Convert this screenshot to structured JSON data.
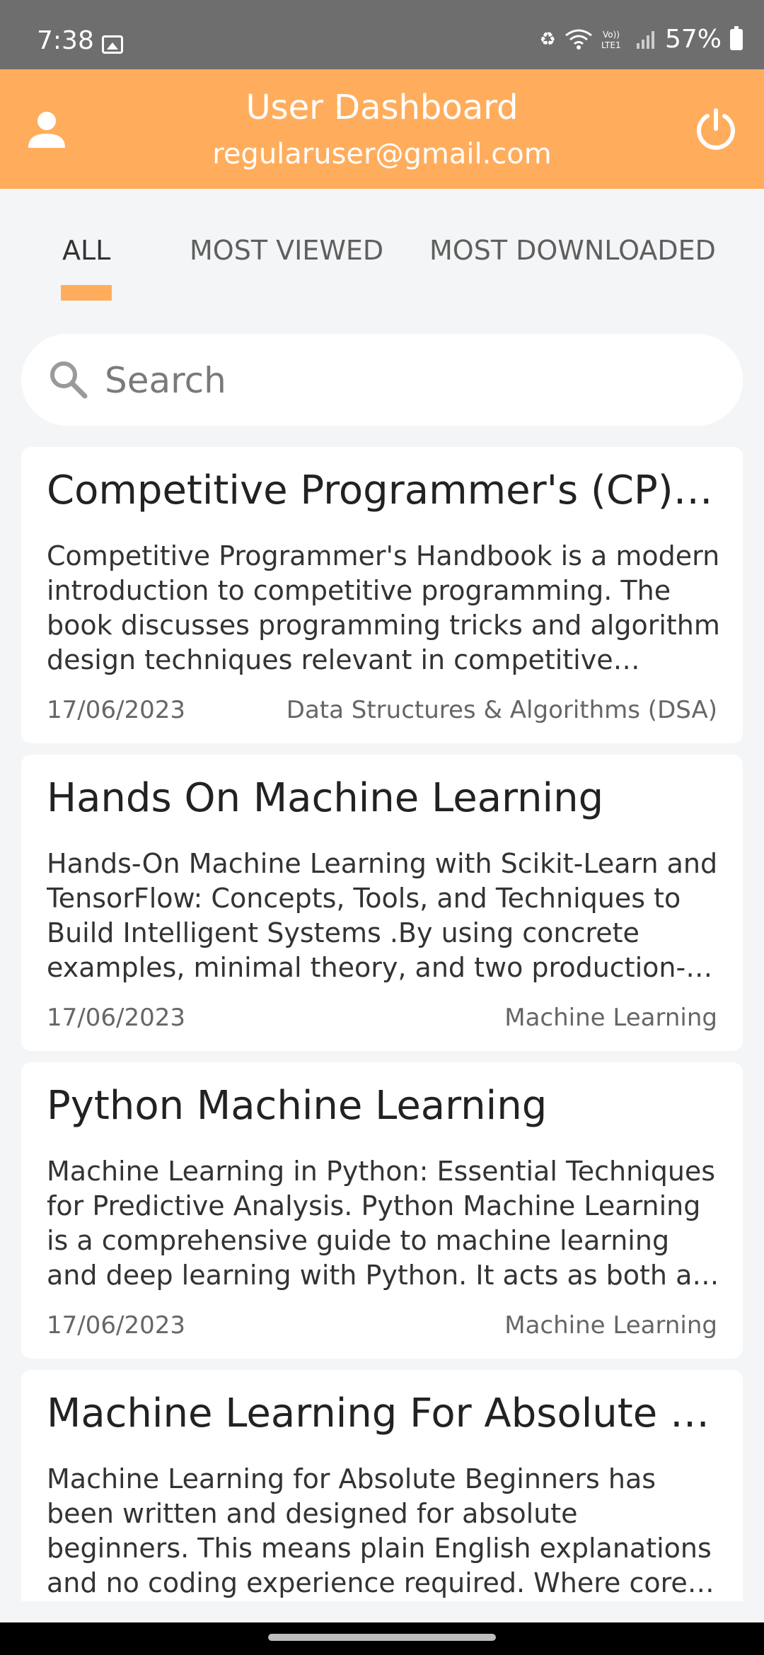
{
  "status_bar": {
    "time": "7:38",
    "battery": "57%",
    "icons": [
      "gallery-icon",
      "recycle-icon",
      "wifi-icon",
      "volte-icon",
      "signal-icon",
      "battery-icon"
    ]
  },
  "header": {
    "title": "User Dashboard",
    "email": "regularuser@gmail.com",
    "accent_color": "#ffad5c"
  },
  "tabs": [
    {
      "label": "ALL",
      "active": true
    },
    {
      "label": "MOST VIEWED",
      "active": false
    },
    {
      "label": "MOST DOWNLOADED",
      "active": false
    }
  ],
  "search": {
    "placeholder": "Search",
    "value": ""
  },
  "cards": [
    {
      "title": "Competitive Programmer's (CP) Handbook",
      "description": "Competitive Programmer's Handbook is a modern introduction to competitive programming. The book discusses programming tricks and algorithm design techniques relevant in competitive programming.",
      "date": "17/06/2023",
      "category": "Data Structures & Algorithms (DSA)"
    },
    {
      "title": "Hands On Machine Learning",
      "description": "Hands-On Machine Learning with Scikit-Learn and TensorFlow: Concepts, Tools, and Techniques to Build Intelligent Systems .By using concrete examples, minimal theory, and two production-ready Python frameworks",
      "date": "17/06/2023",
      "category": "Machine Learning"
    },
    {
      "title": "Python Machine Learning",
      "description": "Machine Learning in Python: Essential Techniques for Predictive Analysis. Python Machine Learning is a comprehensive guide to machine learning and deep learning with Python. It acts as both a step-by-step tutorial",
      "date": "17/06/2023",
      "category": "Machine Learning"
    },
    {
      "title": "Machine Learning For Absolute Beginners",
      "description": "Machine Learning for Absolute Beginners has been written and designed for absolute beginners. This means plain English explanations and no coding experience required. Where core algorithms are introduced",
      "date": "",
      "category": ""
    }
  ]
}
